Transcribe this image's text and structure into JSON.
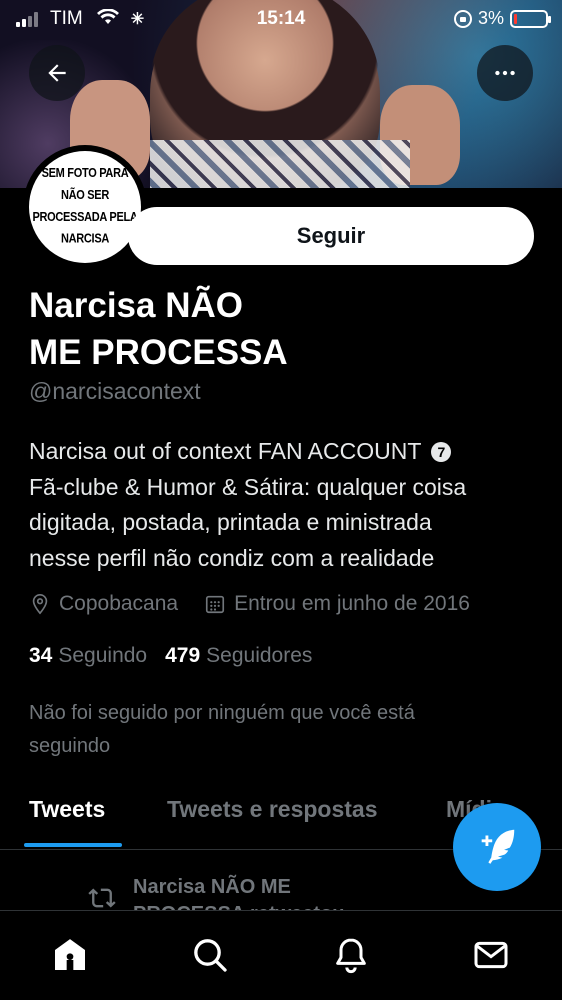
{
  "status_bar": {
    "carrier": "TIM",
    "time": "15:14",
    "battery": "3%"
  },
  "profile": {
    "avatar_text_lines": [
      "SEM FOTO PARA",
      "NÃO SER",
      "PROCESSADA PELA",
      "NARCISA"
    ],
    "follow_label": "Seguir",
    "name_line1": "Narcisa NÃO",
    "name_line2": "ME PROCESSA",
    "handle": "@narcisacontext",
    "bio_line1": "Narcisa out of context FAN ACCOUNT",
    "bio_badge": "7",
    "bio_line2": "Fã-clube & Humor & Sátira: qualquer coisa",
    "bio_line3": "digitada, postada, printada e ministrada",
    "bio_line4": "nesse perfil não condiz com a realidade",
    "location": "Copobacana",
    "joined": "Entrou em junho de 2016",
    "following_count": "34",
    "following_label": "Seguindo",
    "followers_count": "479",
    "followers_label": "Seguidores",
    "not_followed_line1": "Não foi seguido por ninguém que você está",
    "not_followed_line2": "seguindo"
  },
  "tabs": [
    {
      "label": "Tweets",
      "active": true
    },
    {
      "label": "Tweets e respostas",
      "active": false
    },
    {
      "label": "Mídia",
      "active": false
    }
  ],
  "retweet": {
    "line1": "Narcisa NÃO ME",
    "line2": "PROCESSA retweetou"
  },
  "icons": {
    "back": "arrow-left-icon",
    "more": "more-horizontal-icon",
    "location": "location-pin-icon",
    "calendar": "calendar-icon",
    "retweet": "retweet-icon",
    "compose": "compose-tweet-icon",
    "home": "home-icon",
    "search": "search-icon",
    "notifications": "bell-icon",
    "messages": "mail-icon"
  },
  "colors": {
    "accent": "#1d9bf0",
    "background": "#000000",
    "secondary_text": "#71767b"
  }
}
